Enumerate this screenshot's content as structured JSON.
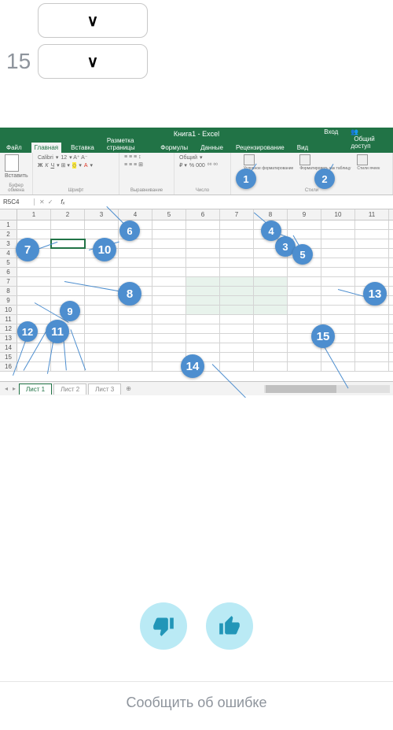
{
  "top_dropdowns": [
    {
      "num": ""
    },
    {
      "num": "15"
    }
  ],
  "excel": {
    "title": "Книга1 - Excel",
    "tabs": {
      "file": "Файл",
      "home": "Главная",
      "insert": "Вставка",
      "layout": "Разметка страницы",
      "formulas": "Формулы",
      "data": "Данные",
      "review": "Рецензирование",
      "view": "Вид",
      "signin": "Вход",
      "share": "Общий доступ"
    },
    "ribbon": {
      "paste": "Вставить",
      "buffer": "Буфер обмена",
      "font_name": "Calibri",
      "font_size": "12",
      "font_grp": "Шрифт",
      "align_grp": "Выравнивание",
      "number_fmt": "Общий",
      "number_pct": "% 000",
      "number_grp": "Число",
      "cond": "Условное форматирование",
      "tbl": "Форматировать как таблицу",
      "styles": "Стили ячеек",
      "styles_grp": "Стили"
    },
    "namebox": "R5C4",
    "cols": [
      "1",
      "2",
      "3",
      "4",
      "5",
      "6",
      "7",
      "8",
      "9",
      "10",
      "11"
    ],
    "rows": [
      "1",
      "2",
      "3",
      "4",
      "5",
      "6",
      "7",
      "8",
      "9",
      "10",
      "11",
      "12",
      "13",
      "14",
      "15",
      "16"
    ],
    "sheets": {
      "s1": "Лист 1",
      "s2": "Лист 2",
      "s3": "Лист 3"
    }
  },
  "callouts": {
    "1": "1",
    "2": "2",
    "3": "3",
    "4": "4",
    "5": "5",
    "6": "6",
    "7": "7",
    "8": "8",
    "9": "9",
    "10": "10",
    "11": "11",
    "12": "12",
    "13": "13",
    "14": "14",
    "15": "15"
  },
  "feedback": {
    "report_error": "Сообщить об ошибке"
  }
}
